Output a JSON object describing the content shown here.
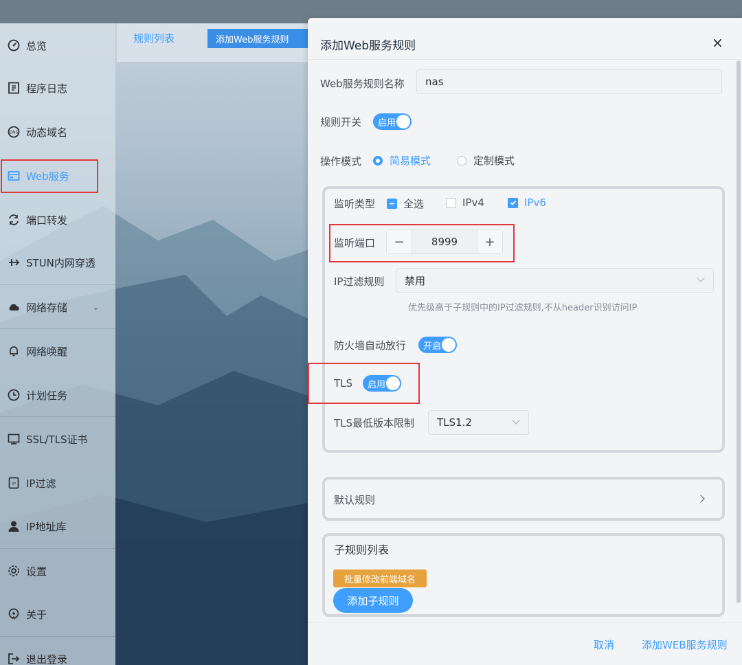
{
  "sidebar": {
    "items": [
      {
        "label": "总览",
        "icon": "dashboard-icon"
      },
      {
        "label": "程序日志",
        "icon": "log-icon"
      },
      {
        "label": "动态域名",
        "icon": "dns-icon"
      },
      {
        "label": "Web服务",
        "icon": "web-service-icon",
        "active": true
      },
      {
        "label": "端口转发",
        "icon": "port-forward-icon"
      },
      {
        "label": "STUN内网穿透",
        "icon": "stun-icon"
      },
      {
        "label": "网络存储",
        "icon": "cloud-storage-icon",
        "has_children": true
      },
      {
        "label": "网络唤醒",
        "icon": "bell-icon"
      },
      {
        "label": "计划任务",
        "icon": "clock-icon"
      },
      {
        "label": "SSL/TLS证书",
        "icon": "certificate-icon"
      },
      {
        "label": "IP过滤",
        "icon": "ip-filter-icon"
      },
      {
        "label": "IP地址库",
        "icon": "user-icon"
      },
      {
        "label": "设置",
        "icon": "gear-icon"
      },
      {
        "label": "关于",
        "icon": "about-icon"
      },
      {
        "label": "退出登录",
        "icon": "logout-icon"
      }
    ]
  },
  "tabs": {
    "list_label": "规则列表",
    "add_label": "添加Web服务规则"
  },
  "dialog": {
    "title": "添加Web服务规则",
    "close_symbol": "×",
    "name_label": "Web服务规则名称",
    "name_value": "nas",
    "rule_switch_label": "规则开关",
    "rule_switch_text": "启用",
    "mode_label": "操作模式",
    "mode_simple": "简易模式",
    "mode_custom": "定制模式",
    "listen_type_label": "监听类型",
    "check_all": "全选",
    "check_ipv4": "IPv4",
    "check_ipv6": "IPv6",
    "listen_port_label": "监听端口",
    "listen_port_value": "8999",
    "stepper_minus": "−",
    "stepper_plus": "+",
    "ip_filter_label": "IP过滤规则",
    "ip_filter_value": "禁用",
    "ip_filter_hint": "优先级高于子规则中的IP过滤规则,不从header识别访问IP",
    "firewall_label": "防火墙自动放行",
    "firewall_switch_text": "开启",
    "tls_label": "TLS",
    "tls_switch_text": "启用",
    "tls_min_label": "TLS最低版本限制",
    "tls_min_value": "TLS1.2",
    "default_rule_label": "默认规则",
    "sub_rules_label": "子规则列表",
    "batch_edit_button": "批量修改前端域名",
    "add_sub_rule_button": "添加子规则",
    "cancel_button": "取消",
    "submit_button": "添加WEB服务规则"
  },
  "colors": {
    "accent": "#409eff",
    "highlight": "#e0393e",
    "warning": "#e6a23c"
  }
}
